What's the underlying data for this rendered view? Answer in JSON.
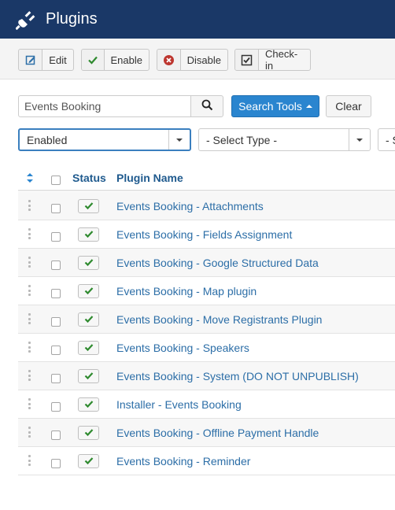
{
  "header": {
    "title": "Plugins",
    "icon": "plug-icon",
    "bg_color": "#1a3867"
  },
  "toolbar": {
    "buttons": [
      {
        "label": "Edit",
        "icon": "edit-icon"
      },
      {
        "label": "Enable",
        "icon": "check-icon"
      },
      {
        "label": "Disable",
        "icon": "close-circle-icon"
      },
      {
        "label": "Check-in",
        "icon": "checkbox-icon"
      }
    ]
  },
  "filters": {
    "search_value": "Events Booking",
    "search_tools_label": "Search Tools",
    "clear_label": "Clear",
    "status_select": "Enabled",
    "type_select": "- Select Type -",
    "third_select": "- S"
  },
  "table": {
    "columns": {
      "status": "Status",
      "name": "Plugin Name"
    },
    "rows": [
      {
        "name": "Events Booking - Attachments",
        "enabled": true
      },
      {
        "name": "Events Booking - Fields Assignment",
        "enabled": true
      },
      {
        "name": "Events Booking - Google Structured Data",
        "enabled": true
      },
      {
        "name": "Events Booking - Map plugin",
        "enabled": true
      },
      {
        "name": "Events Booking - Move Registrants Plugin",
        "enabled": true
      },
      {
        "name": "Events Booking - Speakers",
        "enabled": true
      },
      {
        "name": "Events Booking - System (DO NOT UNPUBLISH)",
        "enabled": true
      },
      {
        "name": "Installer - Events Booking",
        "enabled": true
      },
      {
        "name": "Events Booking - Offline Payment Handle",
        "enabled": true
      },
      {
        "name": "Events Booking - Reminder",
        "enabled": true
      }
    ]
  },
  "colors": {
    "accent": "#2a85cf",
    "link": "#2c6ea7",
    "check": "#2f8a2f"
  }
}
